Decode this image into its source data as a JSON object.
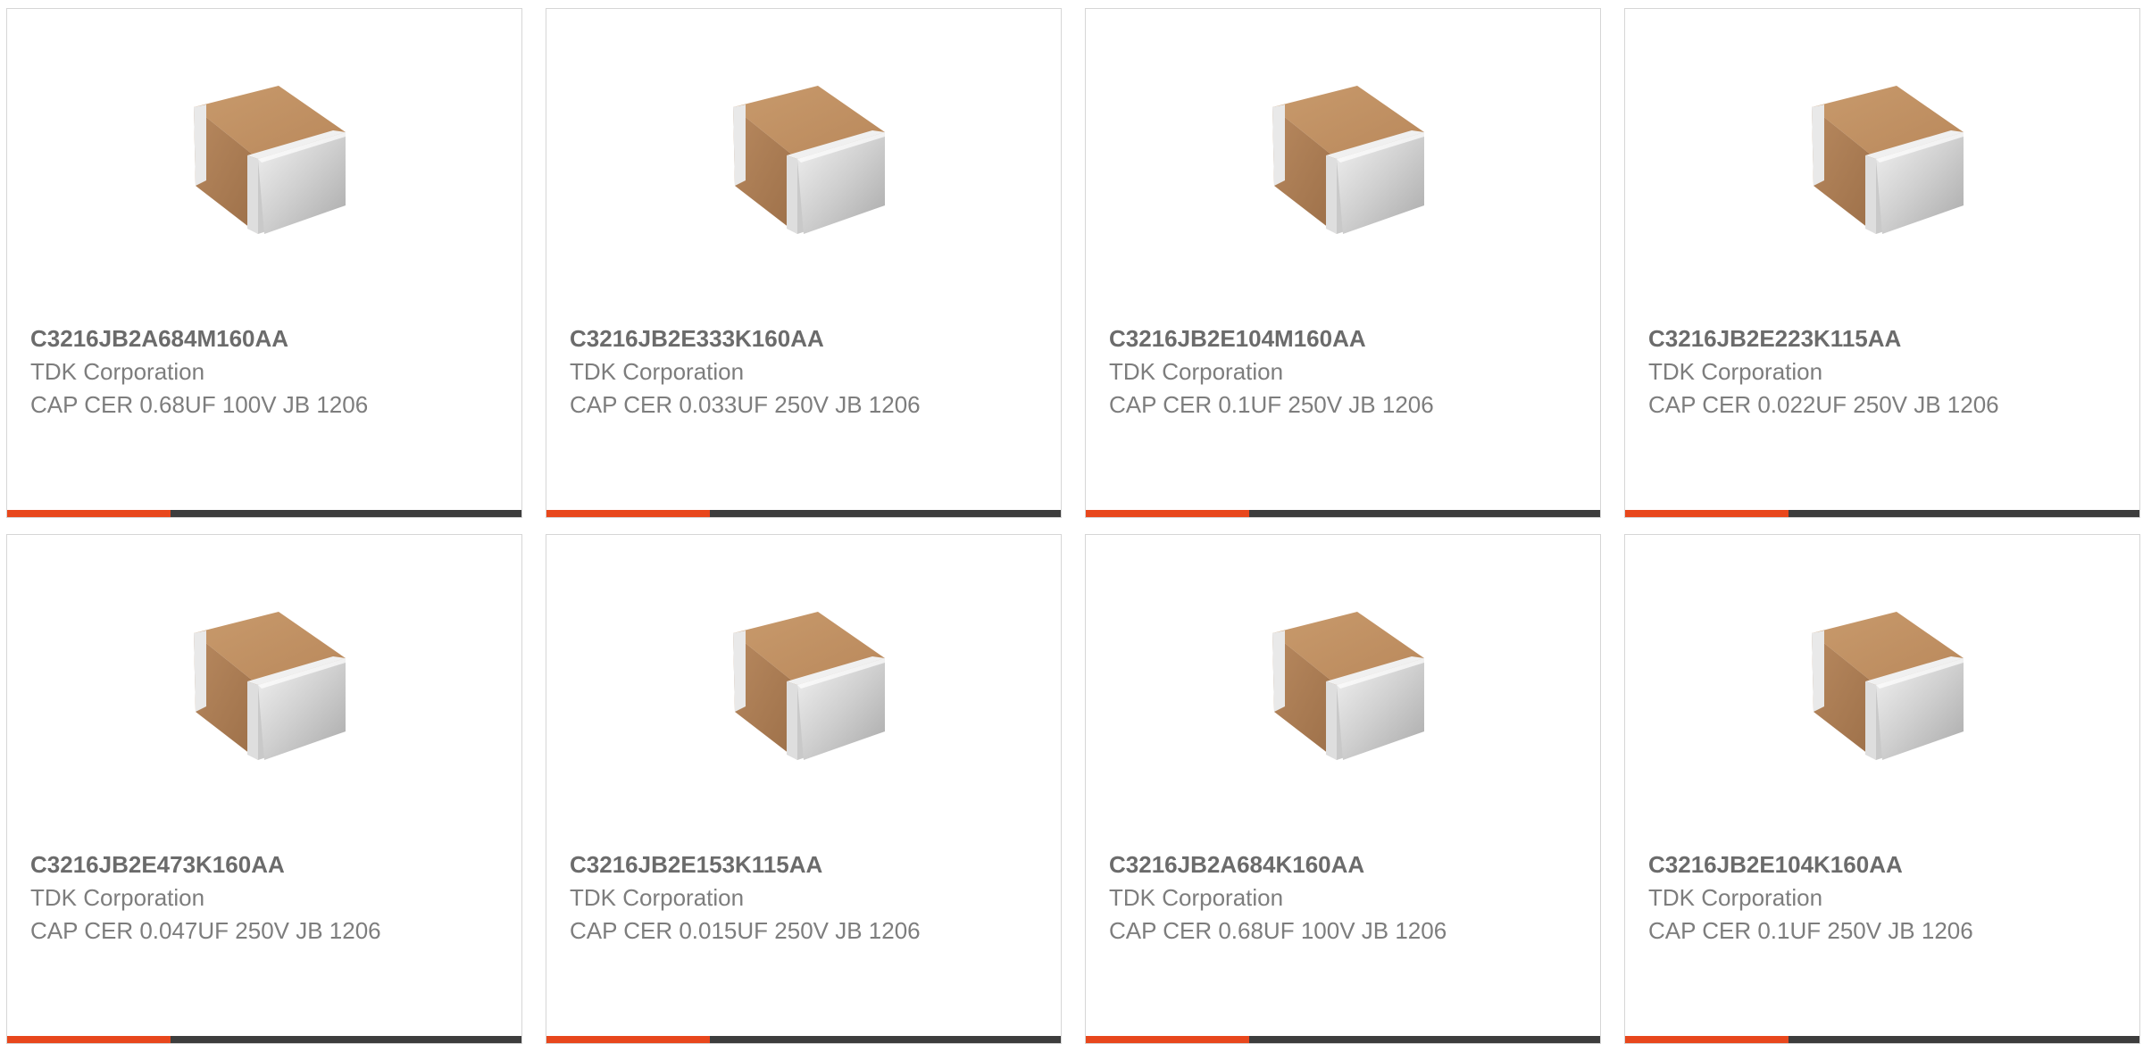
{
  "products": [
    {
      "part_number": "C3216JB2A684M160AA",
      "manufacturer": "TDK Corporation",
      "description": "CAP CER 0.68UF 100V JB 1206",
      "image_icon": "ceramic-capacitor-chip-icon"
    },
    {
      "part_number": "C3216JB2E333K160AA",
      "manufacturer": "TDK Corporation",
      "description": "CAP CER 0.033UF 250V JB 1206",
      "image_icon": "ceramic-capacitor-chip-icon"
    },
    {
      "part_number": "C3216JB2E104M160AA",
      "manufacturer": "TDK Corporation",
      "description": "CAP CER 0.1UF 250V JB 1206",
      "image_icon": "ceramic-capacitor-chip-icon"
    },
    {
      "part_number": "C3216JB2E223K115AA",
      "manufacturer": "TDK Corporation",
      "description": "CAP CER 0.022UF 250V JB 1206",
      "image_icon": "ceramic-capacitor-chip-icon"
    },
    {
      "part_number": "C3216JB2E473K160AA",
      "manufacturer": "TDK Corporation",
      "description": "CAP CER 0.047UF 250V JB 1206",
      "image_icon": "ceramic-capacitor-chip-icon"
    },
    {
      "part_number": "C3216JB2E153K115AA",
      "manufacturer": "TDK Corporation",
      "description": "CAP CER 0.015UF 250V JB 1206",
      "image_icon": "ceramic-capacitor-chip-icon"
    },
    {
      "part_number": "C3216JB2A684K160AA",
      "manufacturer": "TDK Corporation",
      "description": "CAP CER 0.68UF 100V JB 1206",
      "image_icon": "ceramic-capacitor-chip-icon"
    },
    {
      "part_number": "C3216JB2E104K160AA",
      "manufacturer": "TDK Corporation",
      "description": "CAP CER 0.1UF 250V JB 1206",
      "image_icon": "ceramic-capacitor-chip-icon"
    }
  ],
  "colors": {
    "accent": "#e8471c",
    "bar": "#3d3d3d",
    "border": "#d6d6d6",
    "text_bold": "#6b6b6b",
    "text": "#7d7d7d"
  }
}
